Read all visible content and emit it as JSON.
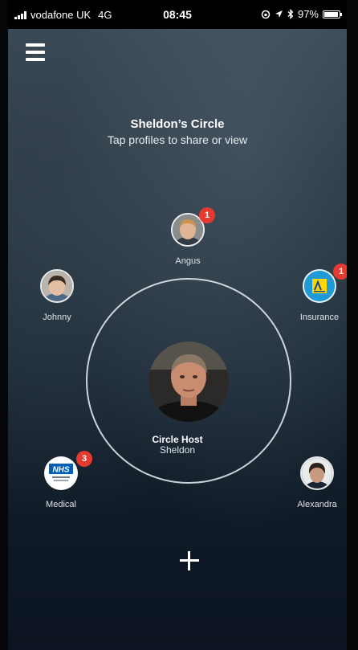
{
  "status_bar": {
    "carrier": "vodafone UK",
    "network": "4G",
    "time": "08:45",
    "battery": "97%",
    "battery_level": 0.97
  },
  "header": {
    "title": "Sheldon’s Circle",
    "subtitle": "Tap profiles to share or view"
  },
  "host": {
    "role": "Circle Host",
    "name": "Sheldon"
  },
  "members": [
    {
      "name": "Angus",
      "badge": "1",
      "avatar": "boy-photo"
    },
    {
      "name": "Johnny",
      "badge": "",
      "avatar": "child-photo"
    },
    {
      "name": "Insurance",
      "badge": "1",
      "avatar": "aviva-logo"
    },
    {
      "name": "Medical",
      "badge": "3",
      "avatar": "nhs-logo",
      "logo_text": "NHS"
    },
    {
      "name": "Alexandra",
      "badge": "",
      "avatar": "woman-photo"
    }
  ],
  "colors": {
    "badge": "#e53a2f",
    "ring": "#ebf0f4",
    "nhs_blue": "#005eb8",
    "aviva_yellow": "#ffd700"
  },
  "icons": [
    "menu-icon",
    "add-icon",
    "signal-icon",
    "location-icon",
    "bluetooth-icon",
    "battery-icon"
  ]
}
